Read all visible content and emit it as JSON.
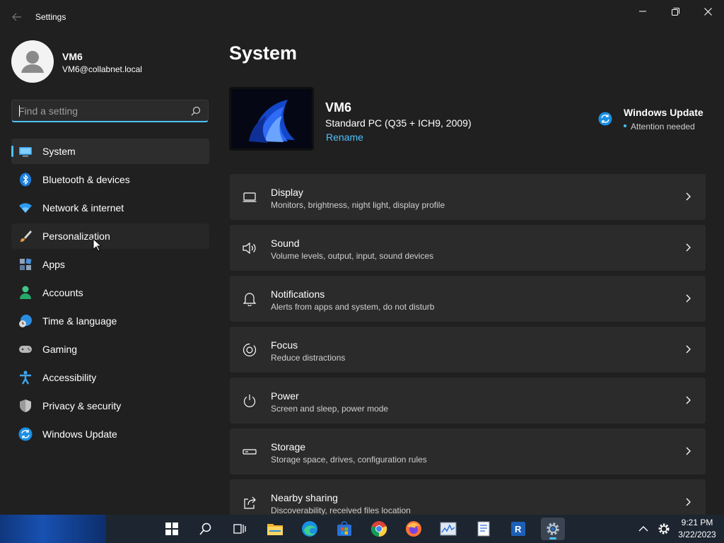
{
  "window": {
    "title": "Settings",
    "back_icon": "arrow-left-icon",
    "controls": [
      "minimize-icon",
      "maximize-icon",
      "close-icon"
    ]
  },
  "profile": {
    "name": "VM6",
    "email": "VM6@collabnet.local"
  },
  "search": {
    "placeholder": "Find a setting",
    "value": ""
  },
  "sidebar": {
    "items": [
      {
        "label": "System",
        "icon": "monitor-icon",
        "selected": true
      },
      {
        "label": "Bluetooth & devices",
        "icon": "bluetooth-icon"
      },
      {
        "label": "Network & internet",
        "icon": "wifi-icon"
      },
      {
        "label": "Personalization",
        "icon": "paintbrush-icon",
        "hover": true
      },
      {
        "label": "Apps",
        "icon": "apps-icon"
      },
      {
        "label": "Accounts",
        "icon": "person-icon"
      },
      {
        "label": "Time & language",
        "icon": "globe-clock-icon"
      },
      {
        "label": "Gaming",
        "icon": "gamepad-icon"
      },
      {
        "label": "Accessibility",
        "icon": "accessibility-icon"
      },
      {
        "label": "Privacy & security",
        "icon": "shield-icon"
      },
      {
        "label": "Windows Update",
        "icon": "update-icon"
      }
    ]
  },
  "main": {
    "title": "System",
    "device": {
      "name": "VM6",
      "model": "Standard PC (Q35 + ICH9, 2009)",
      "rename_label": "Rename"
    },
    "windows_update": {
      "title": "Windows Update",
      "status": "Attention needed"
    },
    "cards": [
      {
        "title": "Display",
        "desc": "Monitors, brightness, night light, display profile",
        "icon": "display-icon"
      },
      {
        "title": "Sound",
        "desc": "Volume levels, output, input, sound devices",
        "icon": "speaker-icon"
      },
      {
        "title": "Notifications",
        "desc": "Alerts from apps and system, do not disturb",
        "icon": "bell-icon"
      },
      {
        "title": "Focus",
        "desc": "Reduce distractions",
        "icon": "focus-icon"
      },
      {
        "title": "Power",
        "desc": "Screen and sleep, power mode",
        "icon": "power-icon"
      },
      {
        "title": "Storage",
        "desc": "Storage space, drives, configuration rules",
        "icon": "drive-icon"
      },
      {
        "title": "Nearby sharing",
        "desc": "Discoverability, received files location",
        "icon": "share-icon"
      }
    ]
  },
  "taskbar": {
    "apps": [
      "start-icon",
      "search-icon",
      "task-view-icon",
      "file-explorer-icon",
      "edge-icon",
      "store-icon",
      "chrome-icon",
      "firefox-icon",
      "monitor-app-icon",
      "notepad-icon",
      "remote-app-icon",
      "settings-icon"
    ],
    "time": "9:21 PM",
    "date": "3/22/2023"
  },
  "colors": {
    "accent": "#4cc2ff",
    "background": "#202020",
    "card": "#2b2b2b"
  }
}
